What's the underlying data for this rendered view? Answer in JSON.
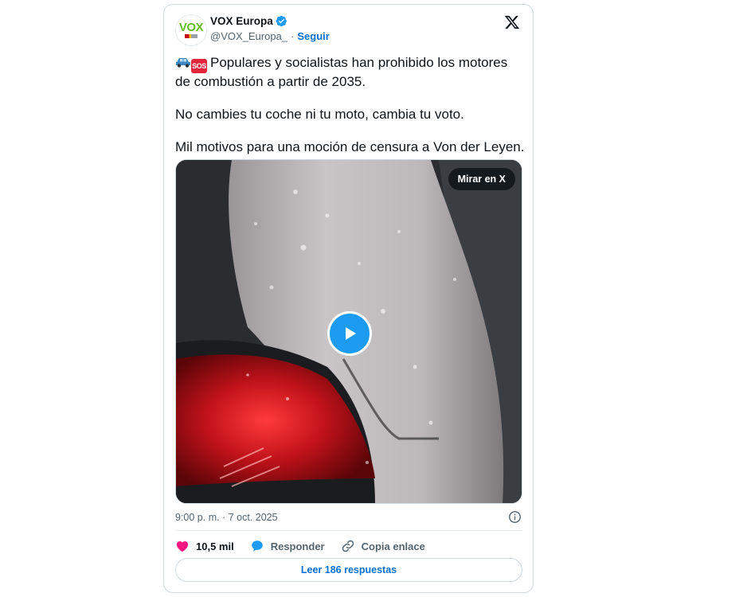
{
  "author": {
    "avatar_text": "VOX",
    "display_name": "VOX Europa",
    "handle": "@VOX_Europa_",
    "separator": "·",
    "follow_label": "Seguir"
  },
  "icons": {
    "close": "x-logo-icon",
    "verified": "verified-badge-icon",
    "emoji_1": "car-emoji-icon",
    "emoji_2": "sos-emoji-icon",
    "play": "play-icon",
    "info": "info-icon",
    "like": "heart-icon",
    "reply": "speech-bubble-icon",
    "copy_link": "link-icon"
  },
  "tweet": {
    "sos_label": "SOS",
    "line1": "Populares y socialistas han prohibido los motores de combustión a partir de 2035.",
    "line2": "No cambies tu coche ni tu moto, cambia tu voto.",
    "line3": "Mil motivos para una moción de censura a Von der Leyen."
  },
  "media": {
    "watch_label": "Mirar en X"
  },
  "meta": {
    "timestamp": "9:00 p. m. · 7 oct. 2025"
  },
  "actions": {
    "likes_count": "10,5 mil",
    "reply_label": "Responder",
    "copy_label": "Copia enlace"
  },
  "replies": {
    "label": "Leer 186 respuestas"
  },
  "colors": {
    "accent": "#1d9bf0",
    "link": "#006fd6",
    "like": "#f91880",
    "brand_green": "#63be21",
    "text_primary": "#0f1419",
    "text_secondary": "#536471",
    "border": "#cfd9de"
  }
}
